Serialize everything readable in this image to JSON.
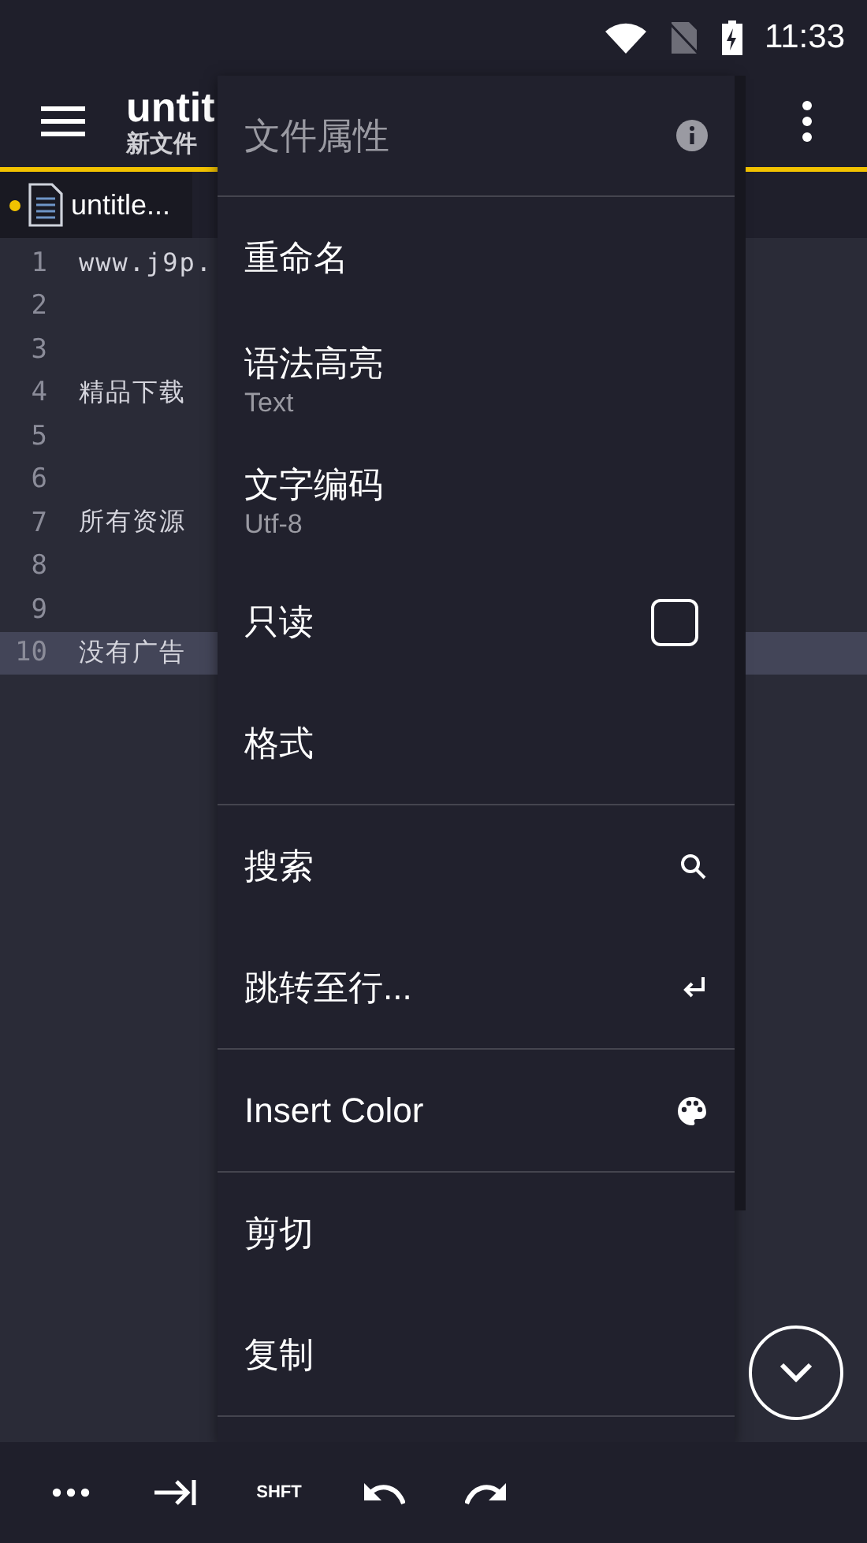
{
  "status_bar": {
    "time": "11:33"
  },
  "app_bar": {
    "title": "untit",
    "subtitle": "新文件"
  },
  "tabs": [
    {
      "label": "untitle...",
      "modified": true
    }
  ],
  "editor": {
    "lines": [
      {
        "number": "1",
        "text": "www.j9p.",
        "selected": false
      },
      {
        "number": "2",
        "selected": false
      },
      {
        "number": "3",
        "selected": false
      },
      {
        "number": "4",
        "text": "精品下载",
        "selected": false
      },
      {
        "number": "5",
        "selected": false
      },
      {
        "number": "6",
        "selected": false
      },
      {
        "number": "7",
        "text": "所有资源",
        "selected": false
      },
      {
        "number": "8",
        "selected": false
      },
      {
        "number": "9",
        "selected": false
      },
      {
        "number": "10",
        "text": "没有广告",
        "selected": true
      }
    ]
  },
  "menu": {
    "header": "文件属性",
    "sections": [
      [
        {
          "kind": "plain",
          "label": "重命名"
        },
        {
          "kind": "detail",
          "label": "语法高亮",
          "detail": "Text"
        },
        {
          "kind": "detail",
          "label": "文字编码",
          "detail": "Utf-8"
        },
        {
          "kind": "check",
          "label": "只读",
          "checked": false
        },
        {
          "kind": "plain",
          "label": "格式"
        }
      ],
      [
        {
          "kind": "search",
          "label": "搜索"
        },
        {
          "kind": "jump",
          "label": "跳转至行..."
        }
      ],
      [
        {
          "kind": "palette",
          "label": "Insert Color"
        }
      ],
      [
        {
          "kind": "plain",
          "label": "剪切"
        },
        {
          "kind": "plain",
          "label": "复制"
        }
      ]
    ]
  },
  "toolbar": [
    {
      "kind": "dots"
    },
    {
      "kind": "tab"
    },
    {
      "kind": "text",
      "label": "SHFT"
    },
    {
      "kind": "undo"
    },
    {
      "kind": "redo"
    }
  ]
}
